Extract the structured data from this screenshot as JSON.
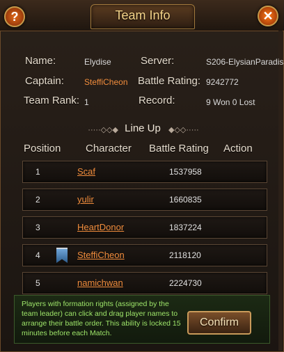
{
  "window": {
    "title": "Team Info"
  },
  "buttons": {
    "help": "?",
    "close": "✕",
    "confirm": "Confirm"
  },
  "team": {
    "name_label": "Name:",
    "name": "Elydise",
    "server_label": "Server:",
    "server": "S206-ElysianParadis",
    "captain_label": "Captain:",
    "captain": "SteffiCheon",
    "battle_rating_label": "Battle Rating:",
    "battle_rating": "9242772",
    "rank_label": "Team Rank:",
    "rank": "1",
    "record_label": "Record:",
    "record": "9 Won 0 Lost"
  },
  "lineup": {
    "title": "Line Up",
    "columns": [
      "Position",
      "Character",
      "Battle Rating",
      "Action"
    ],
    "rows": [
      {
        "position": "1",
        "character": "Scaf",
        "rating": "1537958",
        "captain_icon": false
      },
      {
        "position": "2",
        "character": "yulir",
        "rating": "1660835",
        "captain_icon": false
      },
      {
        "position": "3",
        "character": "HeartDonor",
        "rating": "1837224",
        "captain_icon": false
      },
      {
        "position": "4",
        "character": "SteffiCheon",
        "rating": "2118120",
        "captain_icon": true
      },
      {
        "position": "5",
        "character": "namichwan",
        "rating": "2224730",
        "captain_icon": false
      }
    ]
  },
  "note": "Players with formation rights (assigned by the team leader) can click and drag player names to arrange their battle order. This ability is locked 15 minutes before each Match."
}
